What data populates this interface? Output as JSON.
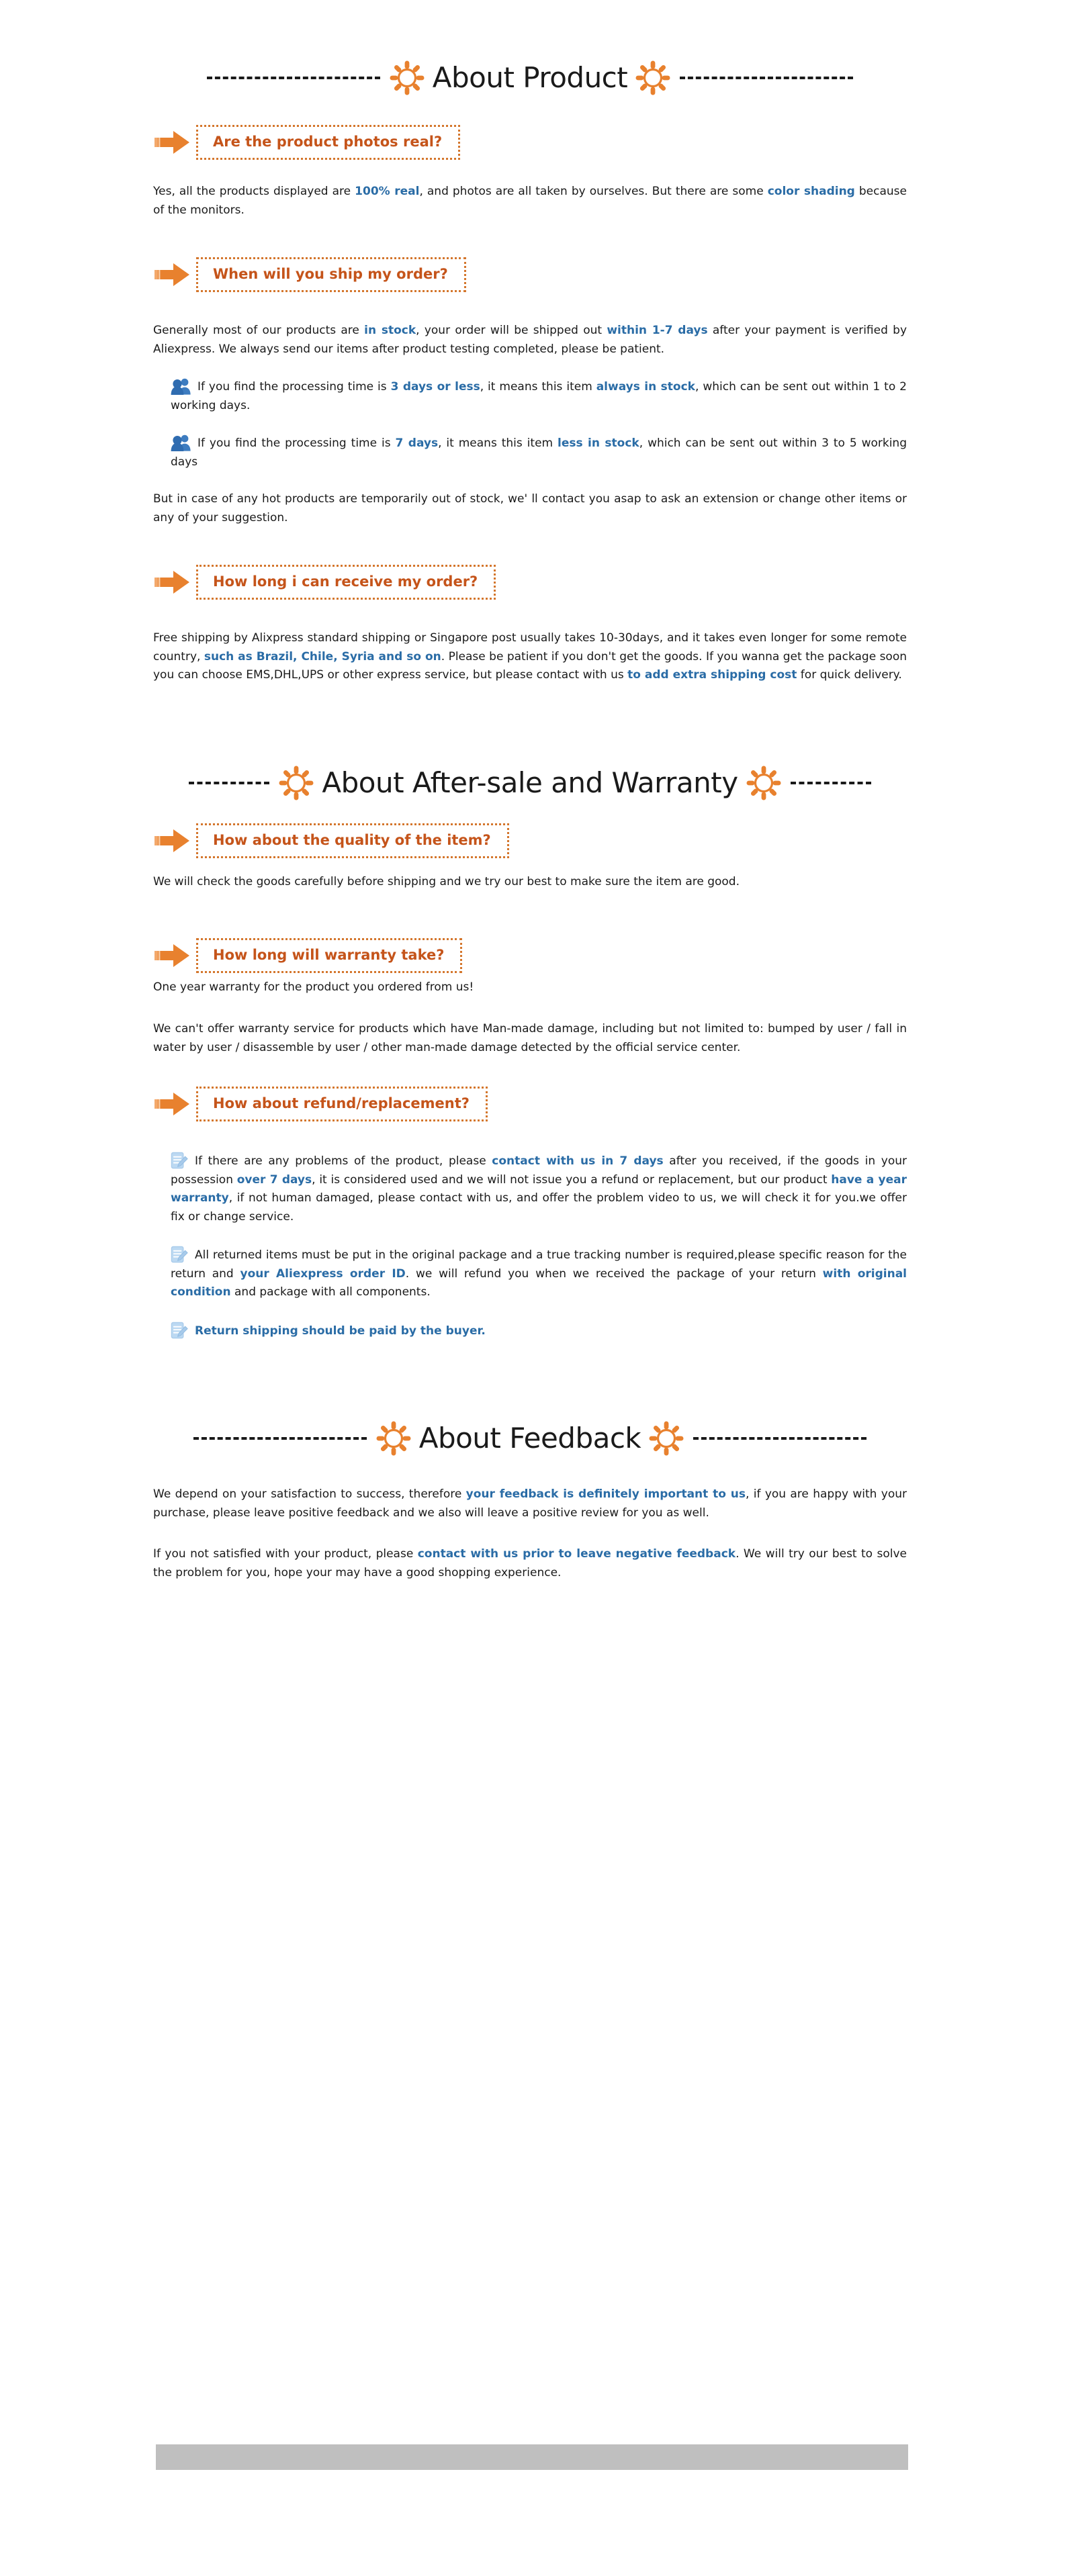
{
  "colors": {
    "orange": "#e8812e",
    "orange_text": "#c5541a",
    "orange_border": "#d4762c",
    "blue_text": "#2a6ca6",
    "blue_icon": "#3d7cc0",
    "note_icon": "#a8cbeb",
    "gray_bar": "#bfbfbf",
    "body_text": "#1a1a1a"
  },
  "sections": {
    "product": {
      "title": "About Product",
      "left_dashes": "----------------",
      "right_dashes": "----------------",
      "sun_left_icon": "sun-icon",
      "sun_right_icon": "sun-icon",
      "q1": {
        "arrow_icon": "arrow-right-icon",
        "question": "Are the product photos real?",
        "answer_parts": [
          {
            "text": "Yes, all the products displayed are ",
            "style": "normal"
          },
          {
            "text": "100% real",
            "style": "highlight"
          },
          {
            "text": ", and photos are all taken by ourselves. But there are some ",
            "style": "normal"
          },
          {
            "text": "color shading",
            "style": "highlight"
          },
          {
            "text": " because of the monitors.",
            "style": "normal"
          }
        ]
      },
      "q2": {
        "arrow_icon": "arrow-right-icon",
        "question": "When will you ship my order?",
        "answer_parts": [
          {
            "text": "Generally most of our products are ",
            "style": "normal"
          },
          {
            "text": "in stock",
            "style": "highlight"
          },
          {
            "text": ", your order will be shipped out ",
            "style": "normal"
          },
          {
            "text": "within 1-7 days",
            "style": "highlight"
          },
          {
            "text": " after your payment is verified by Aliexpress. We always send our items after product testing completed, please be patient.",
            "style": "normal"
          }
        ],
        "bullets": [
          {
            "icon": "people-icon",
            "parts": [
              {
                "text": "If you find the processing time is ",
                "style": "normal"
              },
              {
                "text": "3 days or less",
                "style": "highlight"
              },
              {
                "text": ", it means this item ",
                "style": "normal"
              },
              {
                "text": "always in stock",
                "style": "highlight"
              },
              {
                "text": ", which can be sent out within 1 to 2 working days.",
                "style": "normal"
              }
            ]
          },
          {
            "icon": "people-icon",
            "parts": [
              {
                "text": "If you find the processing time is ",
                "style": "normal"
              },
              {
                "text": "7 days",
                "style": "highlight"
              },
              {
                "text": ", it means this item ",
                "style": "normal"
              },
              {
                "text": "less in stock",
                "style": "highlight"
              },
              {
                "text": ", which can be sent out within 3 to 5 working days",
                "style": "normal"
              }
            ]
          }
        ],
        "closing": "But in case of any hot products are temporarily out of stock, we' ll contact you asap to ask an extension or change other items or any of your suggestion."
      },
      "q3": {
        "arrow_icon": "arrow-right-icon",
        "question": "How long i can receive my order?",
        "answer_parts": [
          {
            "text": "Free shipping by Alixpress standard shipping or Singapore post usually takes 10-30days, and it takes even longer for some remote country, ",
            "style": "normal"
          },
          {
            "text": "such as Brazil, Chile, Syria and so on",
            "style": "highlight"
          },
          {
            "text": ". Please be patient if you don't get the goods. If you wanna get the package soon you can choose EMS,DHL,UPS or other express service, but please contact with us ",
            "style": "normal"
          },
          {
            "text": "to add extra shipping cost",
            "style": "highlight"
          },
          {
            "text": " for quick delivery.",
            "style": "normal"
          }
        ]
      }
    },
    "aftersale": {
      "title": "About After-sale and Warranty",
      "left_dashes": "-------",
      "right_dashes": "------",
      "sun_left_icon": "sun-icon",
      "sun_right_icon": "sun-icon",
      "q1": {
        "arrow_icon": "arrow-right-icon",
        "question": "How about the quality of the item?",
        "answer_parts": [
          {
            "text": "We will check the goods carefully before shipping and we try our best to make sure the item are good.",
            "style": "normal"
          }
        ]
      },
      "q2": {
        "arrow_icon": "arrow-right-icon",
        "question": "How long will warranty take?",
        "answer_parts": [
          {
            "text": "One year warranty for the product you ordered from us!",
            "style": "normal"
          }
        ],
        "second_para": "We can't offer warranty service for products which have Man-made damage, including but not limited to: bumped by user / fall in water by user / disassemble by user / other man-made damage detected by the official service center."
      },
      "q3": {
        "arrow_icon": "arrow-right-icon",
        "question": "How about refund/replacement?",
        "bullets": [
          {
            "icon": "note-icon",
            "parts": [
              {
                "text": "If there are any problems of the product, please ",
                "style": "normal"
              },
              {
                "text": "contact with us in 7 days",
                "style": "highlight"
              },
              {
                "text": " after you received, if the goods in your possession ",
                "style": "normal"
              },
              {
                "text": "over 7 days",
                "style": "highlight"
              },
              {
                "text": ", it is considered used and we will not issue you a refund or replacement, but our product ",
                "style": "normal"
              },
              {
                "text": "have a year warranty",
                "style": "highlight"
              },
              {
                "text": ", if not human damaged, please contact with us, and offer the problem video to us, we will check it for you.we offer fix or change service.",
                "style": "normal"
              }
            ]
          },
          {
            "icon": "note-icon",
            "parts": [
              {
                "text": "All returned items must be put in the original package and a true tracking number is required,please specific reason for the return and ",
                "style": "normal"
              },
              {
                "text": "your Aliexpress order ID",
                "style": "highlight"
              },
              {
                "text": ". we will refund you when we received the package of your return ",
                "style": "normal"
              },
              {
                "text": "with original condition",
                "style": "highlight"
              },
              {
                "text": " and package with all components.",
                "style": "normal"
              }
            ]
          },
          {
            "icon": "note-icon",
            "parts": [
              {
                "text": "Return shipping should be paid by the buyer.",
                "style": "highlight"
              }
            ]
          }
        ]
      }
    },
    "feedback": {
      "title": "About Feedback",
      "left_dashes": "----------------",
      "right_dashes": "----------------",
      "sun_left_icon": "sun-icon",
      "sun_right_icon": "sun-icon",
      "para1_parts": [
        {
          "text": "We depend on your satisfaction to success, therefore ",
          "style": "normal"
        },
        {
          "text": "your feedback is definitely important to us",
          "style": "highlight"
        },
        {
          "text": ", if you are happy with your purchase, please leave positive feedback and we also will leave a positive review for you as well.",
          "style": "normal"
        }
      ],
      "para2_parts": [
        {
          "text": "If you not satisfied with your product, please ",
          "style": "normal"
        },
        {
          "text": "contact with us prior to leave negative feedback",
          "style": "highlight"
        },
        {
          "text": ". We will try our best to solve the problem for you, hope your may have a good shopping experience.",
          "style": "normal"
        }
      ]
    }
  }
}
